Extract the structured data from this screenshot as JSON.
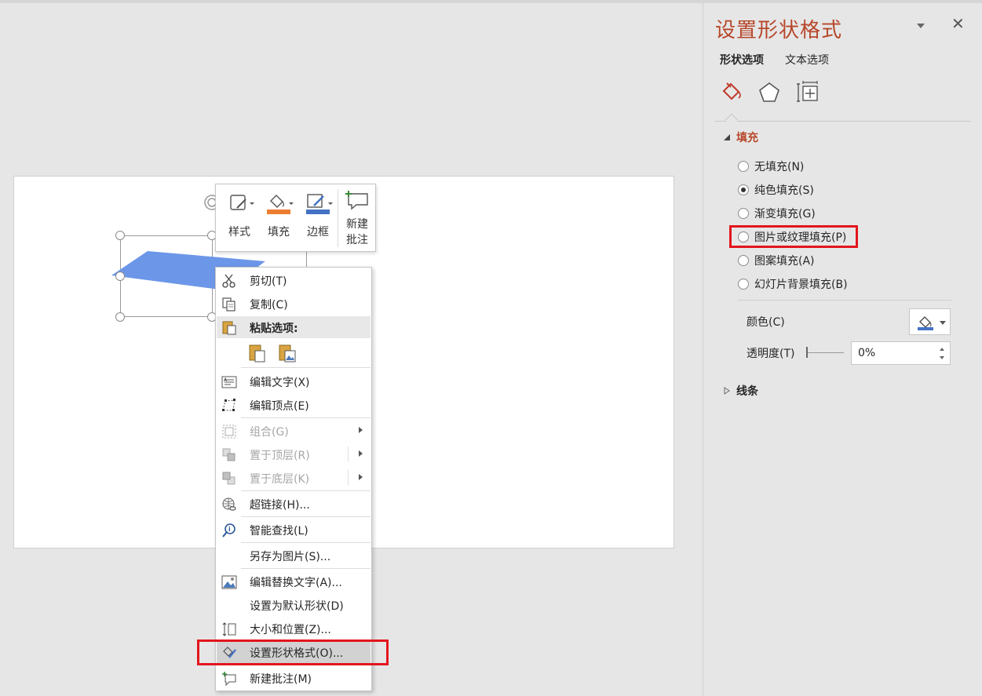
{
  "mini_toolbar": {
    "style_label": "样式",
    "fill_label": "填充",
    "border_label": "边框",
    "comment_label_line1": "新建",
    "comment_label_line2": "批注"
  },
  "context_menu": {
    "cut": "剪切(T)",
    "copy": "复制(C)",
    "paste_options": "粘贴选项:",
    "edit_text": "编辑文字(X)",
    "edit_points": "编辑顶点(E)",
    "group": "组合(G)",
    "bring_to_front": "置于顶层(R)",
    "send_to_back": "置于底层(K)",
    "hyperlink": "超链接(H)...",
    "smart_lookup": "智能查找(L)",
    "save_as_picture": "另存为图片(S)...",
    "edit_alt_text": "编辑替换文字(A)...",
    "set_default_shape": "设置为默认形状(D)",
    "size_position": "大小和位置(Z)...",
    "format_shape": "设置形状格式(O)...",
    "new_comment": "新建批注(M)"
  },
  "pane": {
    "title": "设置形状格式",
    "close_glyph": "✕",
    "tab_shape": "形状选项",
    "tab_text": "文本选项",
    "fill_section": "填充",
    "line_section": "线条",
    "fill_options": [
      {
        "label": "无填充(N)",
        "checked": false
      },
      {
        "label": "纯色填充(S)",
        "checked": true
      },
      {
        "label": "渐变填充(G)",
        "checked": false
      },
      {
        "label": "图片或纹理填充(P)",
        "checked": false
      },
      {
        "label": "图案填充(A)",
        "checked": false
      },
      {
        "label": "幻灯片背景填充(B)",
        "checked": false
      }
    ],
    "color_label": "颜色(C)",
    "transparency_label": "透明度(T)",
    "transparency_value": "0%"
  },
  "colors": {
    "shape_fill": "#6c96e8",
    "accent_red": "#e3151d",
    "title_color": "#b7472a",
    "fill_bar": "#ed7d31",
    "border_bar": "#4472c4"
  }
}
